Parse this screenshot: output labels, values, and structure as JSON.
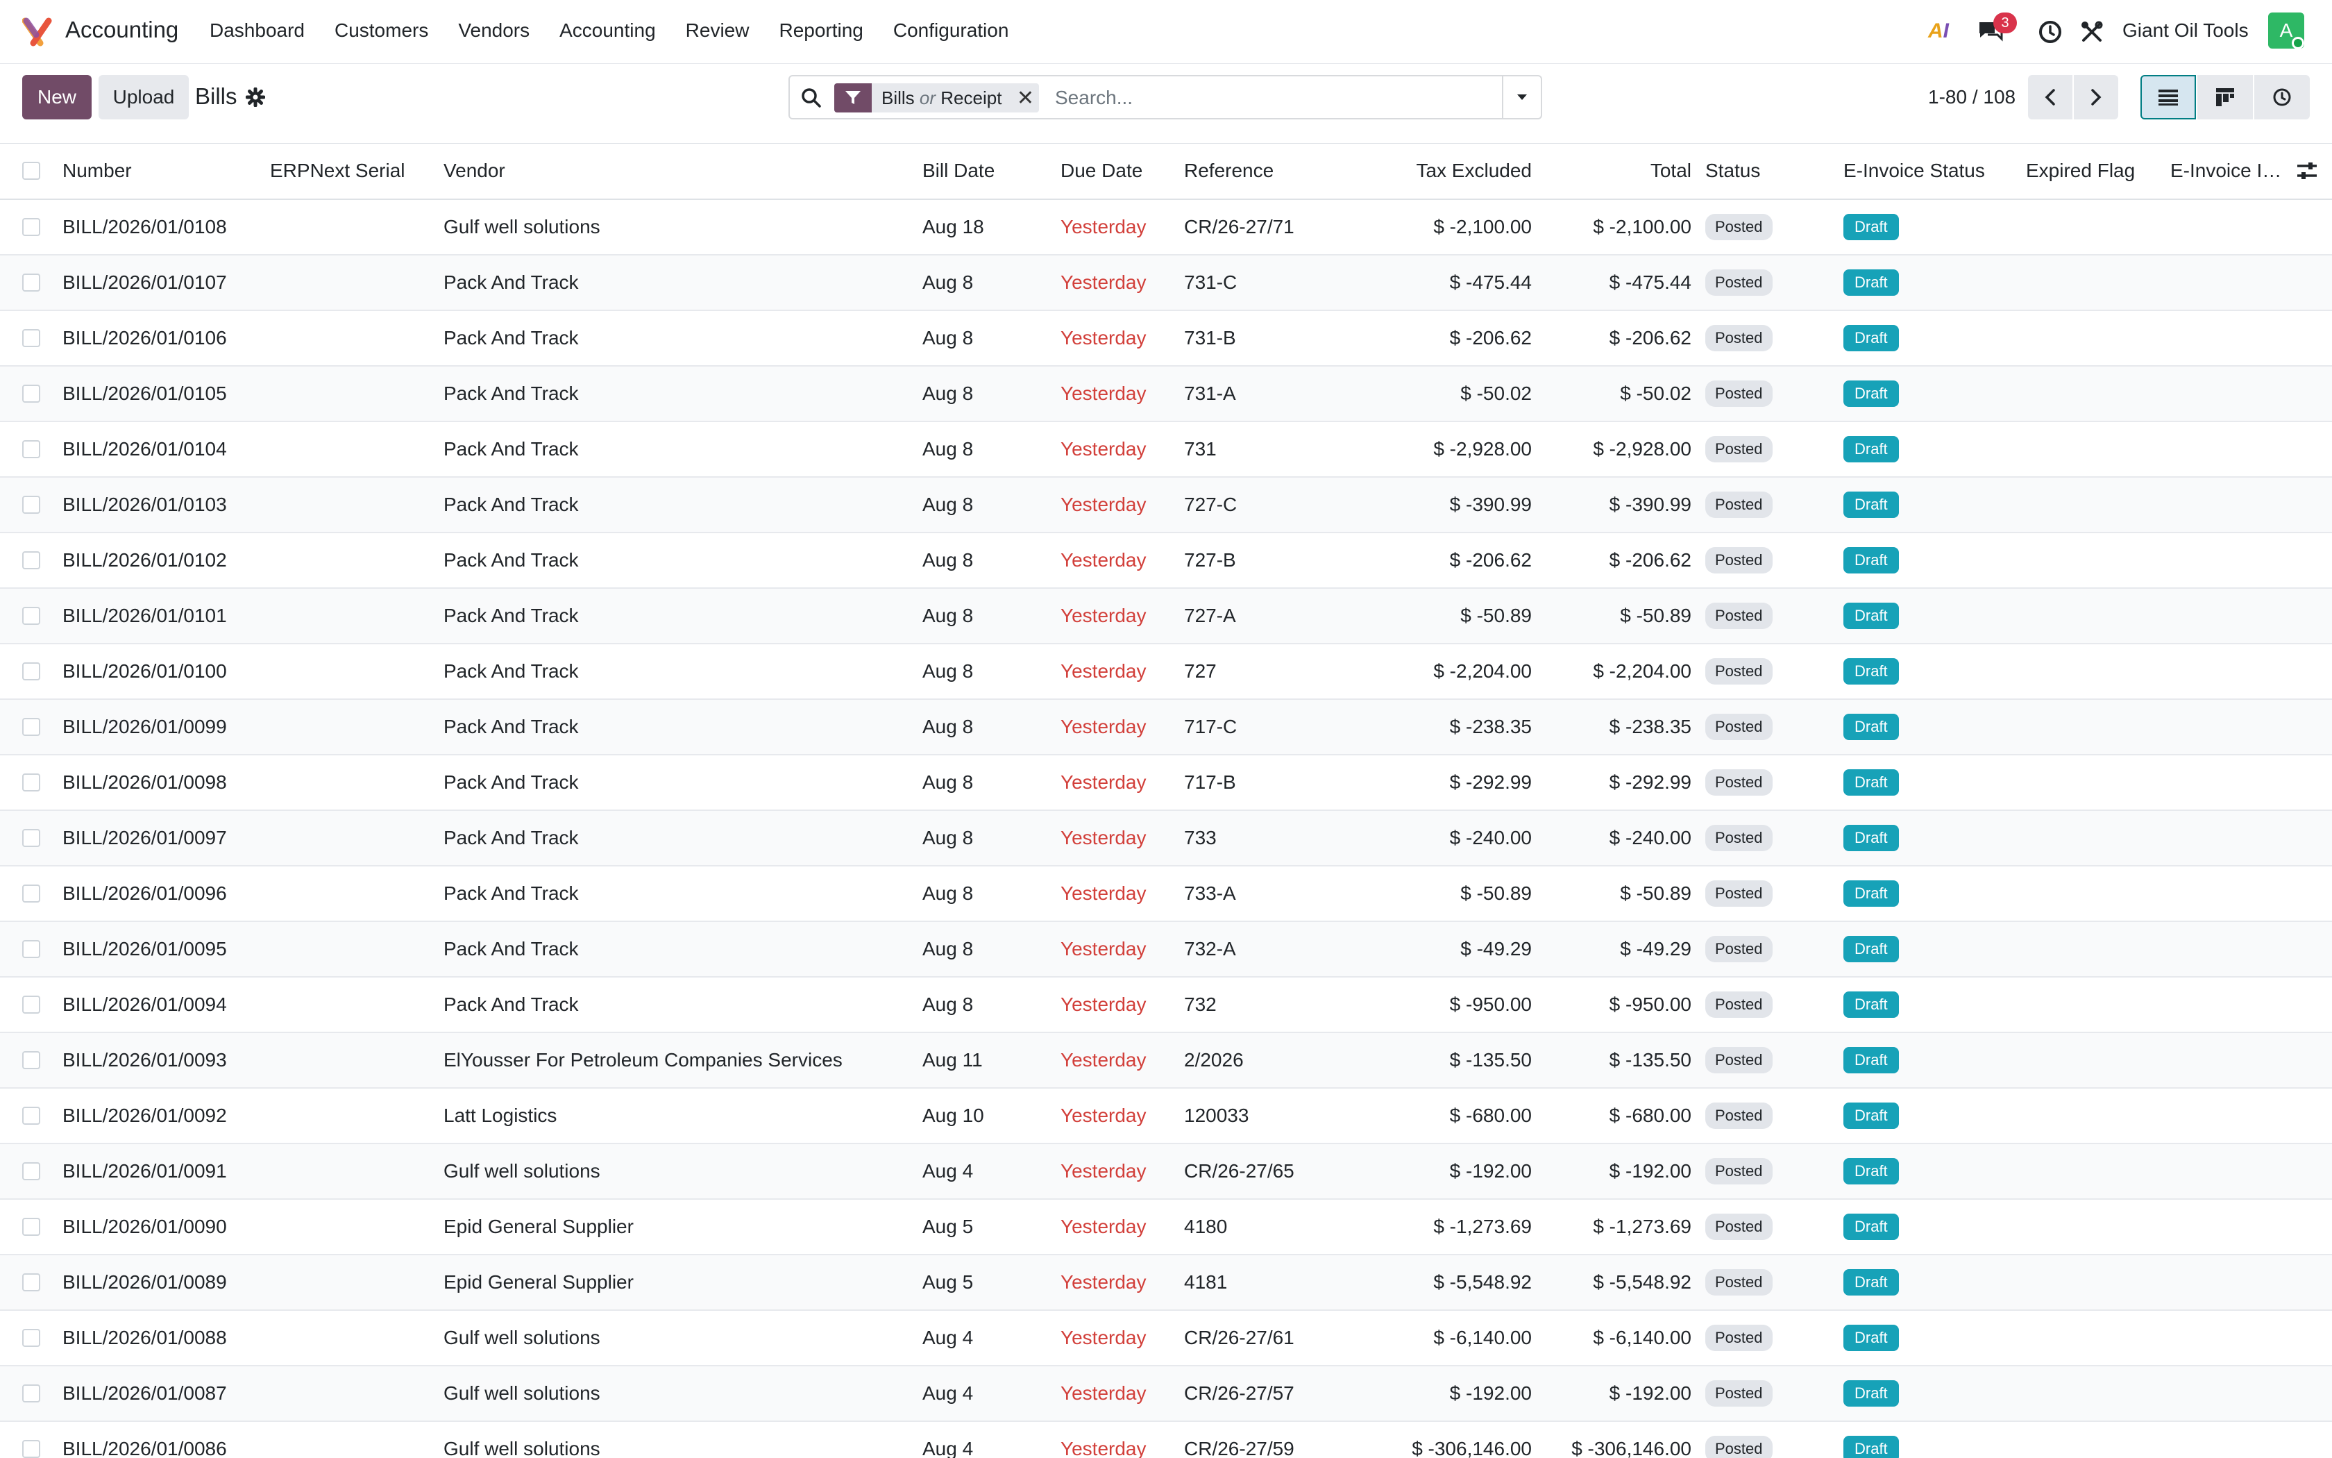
{
  "navbar": {
    "app_name": "Accounting",
    "menu": [
      "Dashboard",
      "Customers",
      "Vendors",
      "Accounting",
      "Review",
      "Reporting",
      "Configuration"
    ],
    "ai_label_a": "A",
    "ai_label_i": "I",
    "chat_badge": "3",
    "company": "Giant Oil Tools",
    "avatar_letter": "A",
    "brand_color": "#714b67",
    "accent_color": "#017e84"
  },
  "control": {
    "new_label": "New",
    "upload_label": "Upload",
    "title": "Bills",
    "facet_primary": "Bills",
    "facet_or": "or",
    "facet_secondary": "Receipt",
    "search_placeholder": "Search...",
    "pager": "1-80 / 108"
  },
  "table": {
    "columns": [
      "Number",
      "ERPNext Serial",
      "Vendor",
      "Bill Date",
      "Due Date",
      "Reference",
      "Tax Excluded",
      "Total",
      "Status",
      "E-Invoice Status",
      "Expired Flag",
      "E-Invoice Inf…"
    ],
    "rows": [
      {
        "number": "BILL/2026/01/0108",
        "serial": "",
        "vendor": "Gulf well solutions",
        "bill_date": "Aug 18",
        "due_date": "Yesterday",
        "reference": "CR/26-27/71",
        "tax_excluded": "$ -2,100.00",
        "total": "$ -2,100.00",
        "status": "Posted",
        "einvoice_status": "Draft"
      },
      {
        "number": "BILL/2026/01/0107",
        "serial": "",
        "vendor": "Pack And Track",
        "bill_date": "Aug 8",
        "due_date": "Yesterday",
        "reference": "731-C",
        "tax_excluded": "$ -475.44",
        "total": "$ -475.44",
        "status": "Posted",
        "einvoice_status": "Draft"
      },
      {
        "number": "BILL/2026/01/0106",
        "serial": "",
        "vendor": "Pack And Track",
        "bill_date": "Aug 8",
        "due_date": "Yesterday",
        "reference": "731-B",
        "tax_excluded": "$ -206.62",
        "total": "$ -206.62",
        "status": "Posted",
        "einvoice_status": "Draft"
      },
      {
        "number": "BILL/2026/01/0105",
        "serial": "",
        "vendor": "Pack And Track",
        "bill_date": "Aug 8",
        "due_date": "Yesterday",
        "reference": "731-A",
        "tax_excluded": "$ -50.02",
        "total": "$ -50.02",
        "status": "Posted",
        "einvoice_status": "Draft"
      },
      {
        "number": "BILL/2026/01/0104",
        "serial": "",
        "vendor": "Pack And Track",
        "bill_date": "Aug 8",
        "due_date": "Yesterday",
        "reference": "731",
        "tax_excluded": "$ -2,928.00",
        "total": "$ -2,928.00",
        "status": "Posted",
        "einvoice_status": "Draft"
      },
      {
        "number": "BILL/2026/01/0103",
        "serial": "",
        "vendor": "Pack And Track",
        "bill_date": "Aug 8",
        "due_date": "Yesterday",
        "reference": "727-C",
        "tax_excluded": "$ -390.99",
        "total": "$ -390.99",
        "status": "Posted",
        "einvoice_status": "Draft"
      },
      {
        "number": "BILL/2026/01/0102",
        "serial": "",
        "vendor": "Pack And Track",
        "bill_date": "Aug 8",
        "due_date": "Yesterday",
        "reference": "727-B",
        "tax_excluded": "$ -206.62",
        "total": "$ -206.62",
        "status": "Posted",
        "einvoice_status": "Draft"
      },
      {
        "number": "BILL/2026/01/0101",
        "serial": "",
        "vendor": "Pack And Track",
        "bill_date": "Aug 8",
        "due_date": "Yesterday",
        "reference": "727-A",
        "tax_excluded": "$ -50.89",
        "total": "$ -50.89",
        "status": "Posted",
        "einvoice_status": "Draft"
      },
      {
        "number": "BILL/2026/01/0100",
        "serial": "",
        "vendor": "Pack And Track",
        "bill_date": "Aug 8",
        "due_date": "Yesterday",
        "reference": "727",
        "tax_excluded": "$ -2,204.00",
        "total": "$ -2,204.00",
        "status": "Posted",
        "einvoice_status": "Draft"
      },
      {
        "number": "BILL/2026/01/0099",
        "serial": "",
        "vendor": "Pack And Track",
        "bill_date": "Aug 8",
        "due_date": "Yesterday",
        "reference": "717-C",
        "tax_excluded": "$ -238.35",
        "total": "$ -238.35",
        "status": "Posted",
        "einvoice_status": "Draft"
      },
      {
        "number": "BILL/2026/01/0098",
        "serial": "",
        "vendor": "Pack And Track",
        "bill_date": "Aug 8",
        "due_date": "Yesterday",
        "reference": "717-B",
        "tax_excluded": "$ -292.99",
        "total": "$ -292.99",
        "status": "Posted",
        "einvoice_status": "Draft"
      },
      {
        "number": "BILL/2026/01/0097",
        "serial": "",
        "vendor": "Pack And Track",
        "bill_date": "Aug 8",
        "due_date": "Yesterday",
        "reference": "733",
        "tax_excluded": "$ -240.00",
        "total": "$ -240.00",
        "status": "Posted",
        "einvoice_status": "Draft"
      },
      {
        "number": "BILL/2026/01/0096",
        "serial": "",
        "vendor": "Pack And Track",
        "bill_date": "Aug 8",
        "due_date": "Yesterday",
        "reference": "733-A",
        "tax_excluded": "$ -50.89",
        "total": "$ -50.89",
        "status": "Posted",
        "einvoice_status": "Draft"
      },
      {
        "number": "BILL/2026/01/0095",
        "serial": "",
        "vendor": "Pack And Track",
        "bill_date": "Aug 8",
        "due_date": "Yesterday",
        "reference": "732-A",
        "tax_excluded": "$ -49.29",
        "total": "$ -49.29",
        "status": "Posted",
        "einvoice_status": "Draft"
      },
      {
        "number": "BILL/2026/01/0094",
        "serial": "",
        "vendor": "Pack And Track",
        "bill_date": "Aug 8",
        "due_date": "Yesterday",
        "reference": "732",
        "tax_excluded": "$ -950.00",
        "total": "$ -950.00",
        "status": "Posted",
        "einvoice_status": "Draft"
      },
      {
        "number": "BILL/2026/01/0093",
        "serial": "",
        "vendor": "ElYousser For Petroleum Companies Services",
        "bill_date": "Aug 11",
        "due_date": "Yesterday",
        "reference": "2/2026",
        "tax_excluded": "$ -135.50",
        "total": "$ -135.50",
        "status": "Posted",
        "einvoice_status": "Draft"
      },
      {
        "number": "BILL/2026/01/0092",
        "serial": "",
        "vendor": "Latt Logistics",
        "bill_date": "Aug 10",
        "due_date": "Yesterday",
        "reference": "120033",
        "tax_excluded": "$ -680.00",
        "total": "$ -680.00",
        "status": "Posted",
        "einvoice_status": "Draft"
      },
      {
        "number": "BILL/2026/01/0091",
        "serial": "",
        "vendor": "Gulf well solutions",
        "bill_date": "Aug 4",
        "due_date": "Yesterday",
        "reference": "CR/26-27/65",
        "tax_excluded": "$ -192.00",
        "total": "$ -192.00",
        "status": "Posted",
        "einvoice_status": "Draft"
      },
      {
        "number": "BILL/2026/01/0090",
        "serial": "",
        "vendor": "Epid General Supplier",
        "bill_date": "Aug 5",
        "due_date": "Yesterday",
        "reference": "4180",
        "tax_excluded": "$ -1,273.69",
        "total": "$ -1,273.69",
        "status": "Posted",
        "einvoice_status": "Draft"
      },
      {
        "number": "BILL/2026/01/0089",
        "serial": "",
        "vendor": "Epid General Supplier",
        "bill_date": "Aug 5",
        "due_date": "Yesterday",
        "reference": "4181",
        "tax_excluded": "$ -5,548.92",
        "total": "$ -5,548.92",
        "status": "Posted",
        "einvoice_status": "Draft"
      },
      {
        "number": "BILL/2026/01/0088",
        "serial": "",
        "vendor": "Gulf well solutions",
        "bill_date": "Aug 4",
        "due_date": "Yesterday",
        "reference": "CR/26-27/61",
        "tax_excluded": "$ -6,140.00",
        "total": "$ -6,140.00",
        "status": "Posted",
        "einvoice_status": "Draft"
      },
      {
        "number": "BILL/2026/01/0087",
        "serial": "",
        "vendor": "Gulf well solutions",
        "bill_date": "Aug 4",
        "due_date": "Yesterday",
        "reference": "CR/26-27/57",
        "tax_excluded": "$ -192.00",
        "total": "$ -192.00",
        "status": "Posted",
        "einvoice_status": "Draft"
      },
      {
        "number": "BILL/2026/01/0086",
        "serial": "",
        "vendor": "Gulf well solutions",
        "bill_date": "Aug 4",
        "due_date": "Yesterday",
        "reference": "CR/26-27/59",
        "tax_excluded": "$ -306,146.00",
        "total": "$ -306,146.00",
        "status": "Posted",
        "einvoice_status": "Draft"
      }
    ]
  }
}
